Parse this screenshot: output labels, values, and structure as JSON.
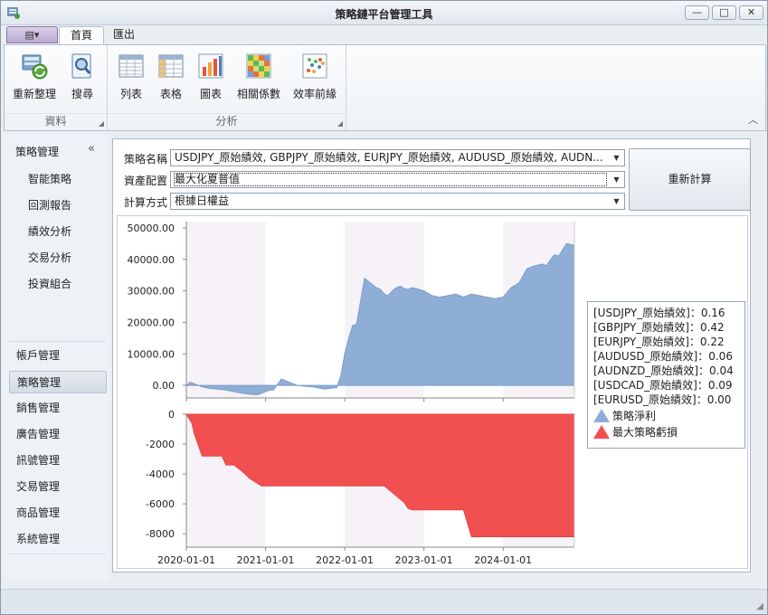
{
  "window": {
    "title": "策略鏈平台管理工具",
    "buttons": {
      "minimize": "—",
      "maximize": "□",
      "close": "✕"
    }
  },
  "ribbon": {
    "app_menu": "▤▾",
    "tabs": [
      {
        "label": "首頁",
        "active": true
      },
      {
        "label": "匯出",
        "active": false
      }
    ],
    "groups": [
      {
        "label": "資料",
        "buttons": [
          {
            "label": "重新整理",
            "icon": "refresh-icon"
          },
          {
            "label": "搜尋",
            "icon": "search-icon"
          }
        ]
      },
      {
        "label": "分析",
        "buttons": [
          {
            "label": "列表",
            "icon": "list-icon"
          },
          {
            "label": "表格",
            "icon": "table-icon"
          },
          {
            "label": "圖表",
            "icon": "bar-chart-icon"
          },
          {
            "label": "相關係數",
            "icon": "heatmap-icon"
          },
          {
            "label": "效率前緣",
            "icon": "scatter-icon"
          }
        ]
      }
    ]
  },
  "sidebar": {
    "header": "策略管理",
    "collapse": "«",
    "sub_items": [
      "智能策略",
      "回測報告",
      "績效分析",
      "交易分析",
      "投資組合"
    ],
    "items": [
      "帳戶管理",
      "策略管理",
      "銷售管理",
      "廣告管理",
      "訊號管理",
      "交易管理",
      "商品管理",
      "系統管理"
    ],
    "selected": "策略管理"
  },
  "form": {
    "strategy_label": "策略名稱",
    "strategy_value": "USDJPY_原始績效, GBPJPY_原始績效, EURJPY_原始績效, AUDUSD_原始績效, AUDN...",
    "allocation_label": "資產配置",
    "allocation_value": "最大化夏普值",
    "calc_label": "計算方式",
    "calc_value": "根據日權益",
    "recalc_button": "重新計算"
  },
  "legend": {
    "weights": [
      "[USDJPY_原始績效]：0.16",
      "[GBPJPY_原始績效]：0.42",
      "[EURJPY_原始績效]：0.22",
      "[AUDUSD_原始績效]：0.06",
      "[AUDNZD_原始績效]：0.04",
      "[USDCAD_原始績效]：0.09",
      "[EURUSD_原始績效]：0.00"
    ],
    "net_profit": "策略淨利",
    "max_drawdown": "最大策略虧損"
  },
  "colors": {
    "profit": "#8eaed6",
    "drawdown": "#f25050",
    "band": "#f6f2f7"
  },
  "chart_data": [
    {
      "type": "area",
      "name": "策略淨利",
      "x_ticks": [
        "2020-01-01",
        "2021-01-01",
        "2022-01-01",
        "2023-01-01",
        "2024-01-01"
      ],
      "y_ticks": [
        "50000.00",
        "40000.00",
        "30000.00",
        "20000.00",
        "10000.00",
        "0.00"
      ],
      "ylim": [
        -4000,
        52000
      ],
      "x": [
        0.0,
        0.05,
        0.1,
        0.2,
        0.3,
        0.4,
        0.5,
        0.6,
        0.7,
        0.8,
        0.9,
        1.0,
        1.05,
        1.1,
        1.2,
        1.3,
        1.4,
        1.5,
        1.6,
        1.7,
        1.75,
        1.8,
        1.9,
        1.95,
        2.0,
        2.05,
        2.1,
        2.15,
        2.25,
        2.3,
        2.35,
        2.4,
        2.45,
        2.5,
        2.55,
        2.6,
        2.65,
        2.7,
        2.75,
        2.8,
        2.85,
        2.9,
        3.0,
        3.1,
        3.2,
        3.3,
        3.4,
        3.5,
        3.6,
        3.7,
        3.8,
        3.9,
        3.95,
        4.0,
        4.1,
        4.2,
        4.3,
        4.4,
        4.5,
        4.55,
        4.6,
        4.65,
        4.7,
        4.75,
        4.8,
        4.9
      ],
      "values": [
        0,
        1000,
        500,
        -500,
        -1000,
        -1200,
        -1500,
        -2000,
        -2500,
        -2800,
        -3000,
        -2000,
        -1500,
        -1500,
        2000,
        1000,
        0,
        -300,
        -500,
        -1000,
        -1200,
        -1000,
        -700,
        3000,
        10000,
        15000,
        19000,
        19500,
        34000,
        33000,
        32000,
        31000,
        30500,
        29000,
        28500,
        30000,
        31000,
        31500,
        30800,
        30500,
        31000,
        30700,
        30000,
        28500,
        28000,
        28500,
        29000,
        28000,
        29000,
        28500,
        28000,
        27500,
        27800,
        28000,
        31000,
        32500,
        37000,
        38000,
        38500,
        38000,
        40000,
        41500,
        41000,
        43000,
        45000,
        44500
      ]
    },
    {
      "type": "area",
      "name": "最大策略虧損",
      "x_ticks": [
        "2020-01-01",
        "2021-01-01",
        "2022-01-01",
        "2023-01-01",
        "2024-01-01"
      ],
      "y_ticks": [
        "0",
        "-2000",
        "-4000",
        "-6000",
        "-8000"
      ],
      "ylim": [
        -8900,
        0
      ],
      "x": [
        0.0,
        0.07,
        0.1,
        0.2,
        0.3,
        0.45,
        0.5,
        0.6,
        0.7,
        0.8,
        0.95,
        1.5,
        2.0,
        2.5,
        2.75,
        2.8,
        2.85,
        3.0,
        3.5,
        3.6,
        4.0,
        4.5,
        4.9
      ],
      "values": [
        0,
        -600,
        -1300,
        -2800,
        -2800,
        -2800,
        -3400,
        -3400,
        -3800,
        -4300,
        -4800,
        -4800,
        -4800,
        -4800,
        -5900,
        -6300,
        -6400,
        -6400,
        -6400,
        -8200,
        -8200,
        -8200,
        -8200
      ]
    }
  ]
}
